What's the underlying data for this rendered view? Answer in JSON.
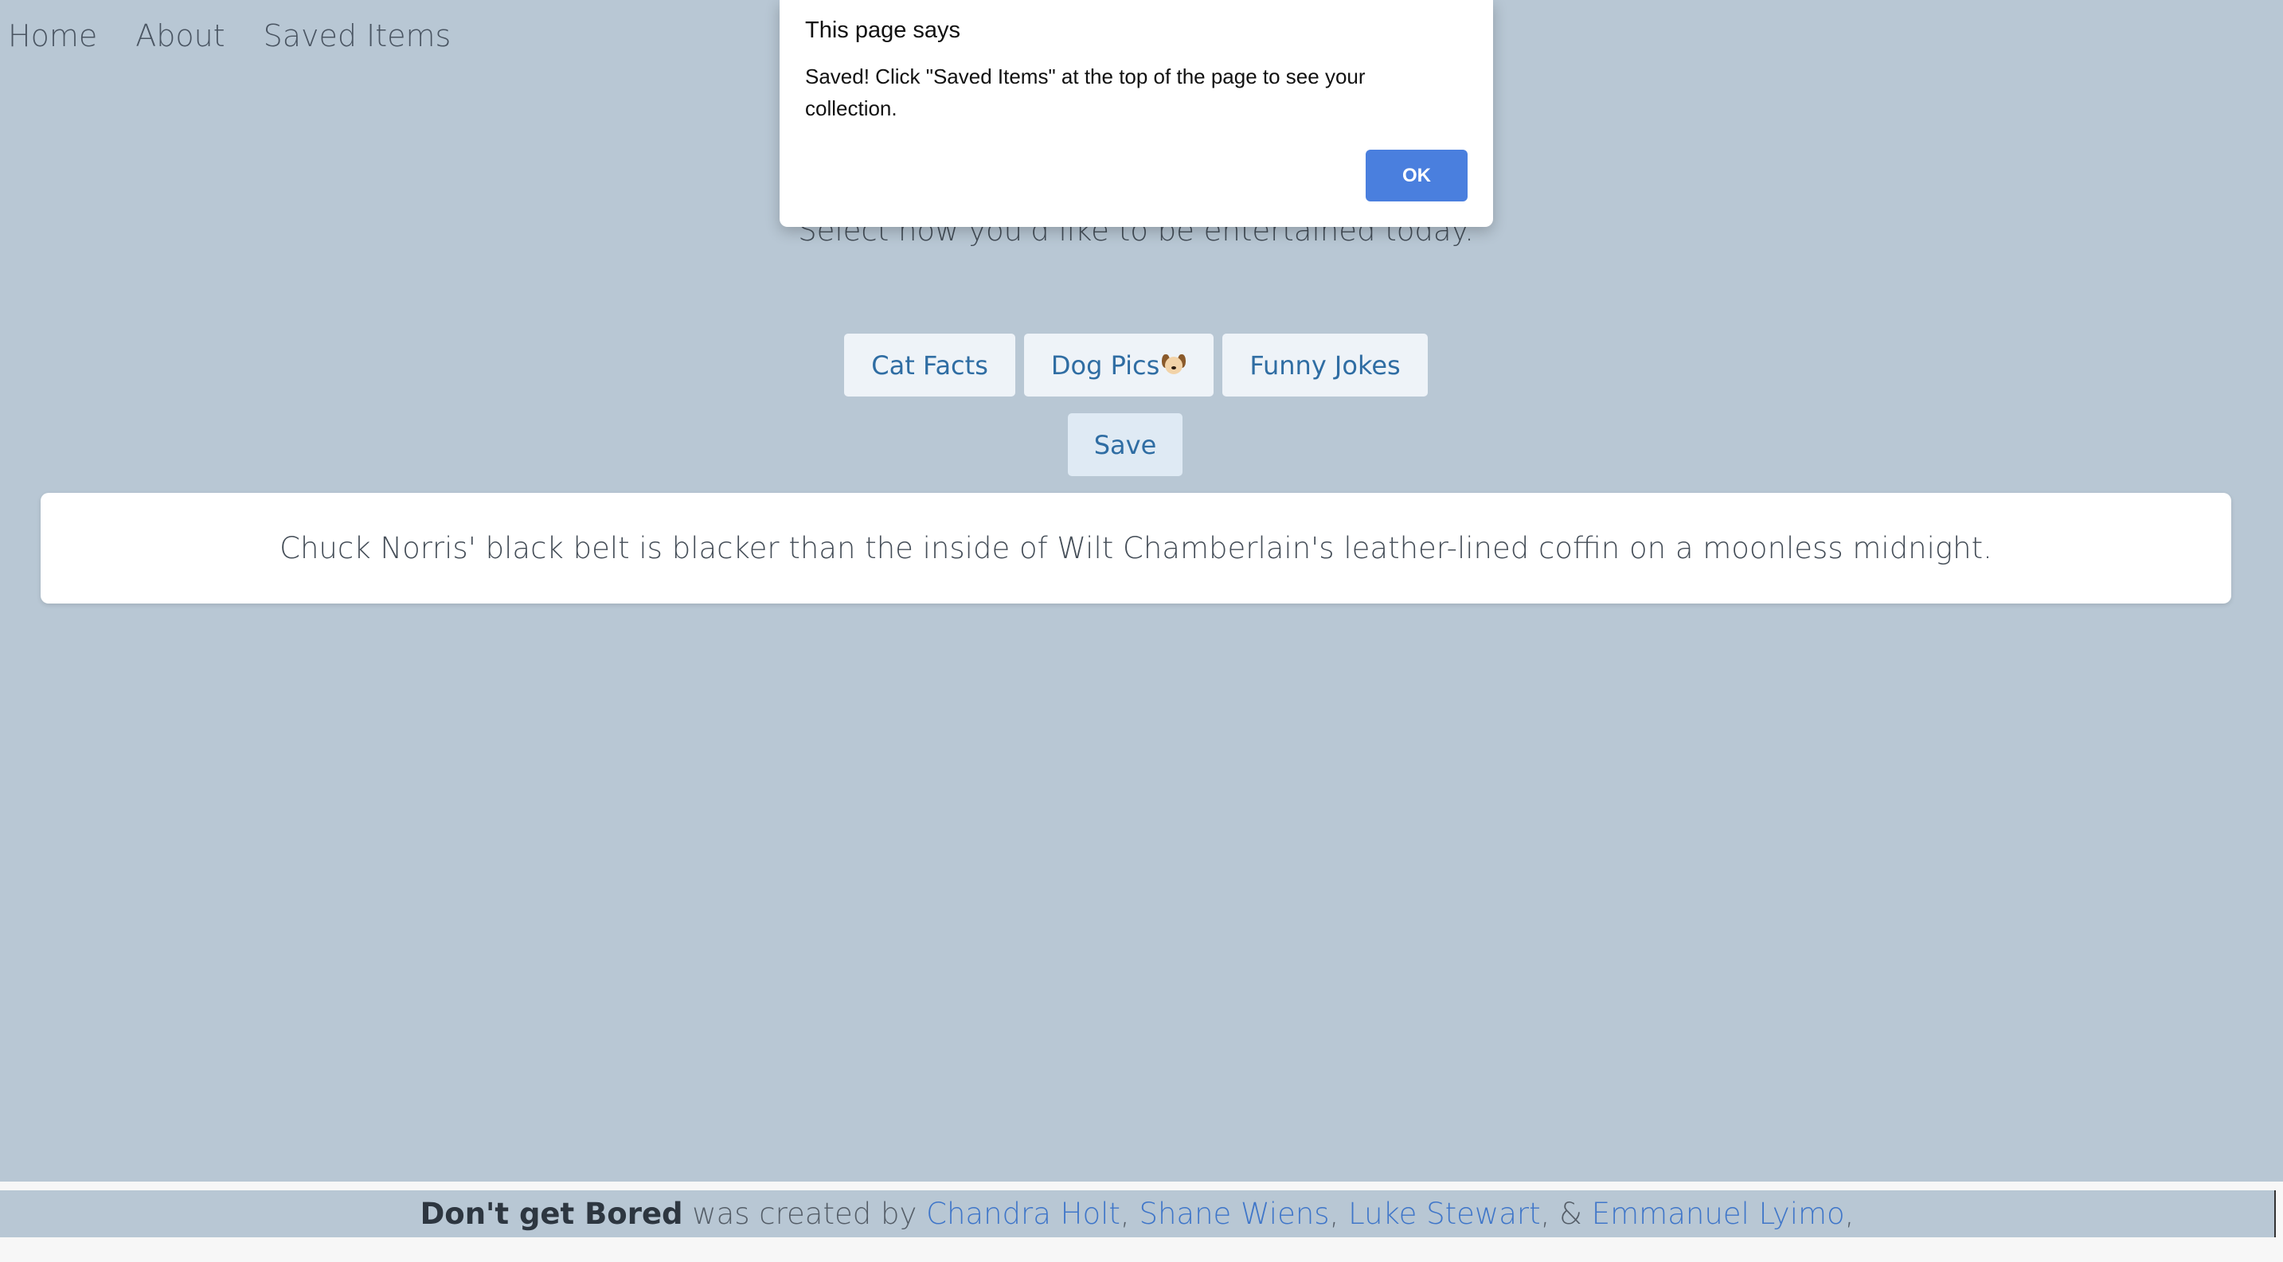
{
  "nav": {
    "items": [
      {
        "label": "Home"
      },
      {
        "label": "About"
      },
      {
        "label": "Saved Items"
      }
    ]
  },
  "main": {
    "subtitle": "Select how you'd like to be entertained today.",
    "buttons": [
      {
        "label": "Cat Facts"
      },
      {
        "label": "Dog Pics",
        "icon": "dog-face-icon"
      },
      {
        "label": "Funny Jokes"
      }
    ],
    "save_label": "Save",
    "content_text": "Chuck Norris' black belt is blacker than the inside of Wilt Chamberlain's leather-lined coffin on a moonless midnight."
  },
  "footer": {
    "brand": "Don't get Bored",
    "created_by": " was created by ",
    "authors": [
      "Chandra Holt",
      "Shane Wiens",
      "Luke Stewart",
      "Emmanuel Lyimo"
    ],
    "separator": ", ",
    "amp": ", & ",
    "trailing": ","
  },
  "dialog": {
    "title": "This page says",
    "message": "Saved! Click \"Saved Items\" at the top of the page to see your collection.",
    "ok_label": "OK"
  },
  "colors": {
    "background": "#b8c7d4",
    "button_bg": "#eef3f8",
    "button_text": "#2f6da3",
    "link": "#3f76c9",
    "dialog_ok": "#4a7fde"
  }
}
